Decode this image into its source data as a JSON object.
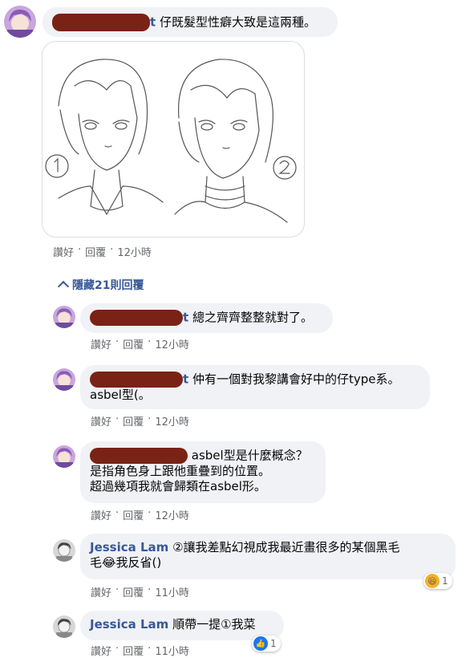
{
  "comment": {
    "author_suffix": "t",
    "text": "仔既髮型性癖大致是這兩種。",
    "actions": {
      "like": "讚好",
      "reply": "回覆",
      "time": "12小時"
    },
    "image_labels": [
      "1",
      "2"
    ]
  },
  "hide_replies": "隱藏21則回覆",
  "replies": [
    {
      "author_suffix": "t",
      "text": "總之齊齊整整就對了。",
      "like": "讚好",
      "reply": "回覆",
      "time": "12小時"
    },
    {
      "author_suffix": "t",
      "text_line1": "仲有一個對我黎講會好中的仔type系。",
      "text_line2": "asbel型(。",
      "like": "讚好",
      "reply": "回覆",
      "time": "12小時"
    },
    {
      "text_line1": "asbel型是什麼概念？",
      "text_line2": "是指角色身上跟他重疊到的位置。",
      "text_line3": "超過幾項我就會歸類在asbel形。",
      "like": "讚好",
      "reply": "回覆",
      "time": "12小時"
    },
    {
      "author": "Jessica Lam",
      "text_line1": "②讓我差點幻視成我最近畫很多的某個黑毛",
      "text_line2_a": "毛",
      "text_line2_b": "我反省()",
      "emoji": "😂",
      "reaction_count": "1",
      "like": "讚好",
      "reply": "回覆",
      "time": "11小時"
    },
    {
      "author": "Jessica Lam",
      "text": "順帶一提①我菜",
      "reaction_count": "1",
      "like": "讚好",
      "reply": "回覆",
      "time": "11小時"
    }
  ],
  "colors": {
    "link": "#385898",
    "bubble": "#f0f2f5",
    "redaction": "#7a2216"
  }
}
